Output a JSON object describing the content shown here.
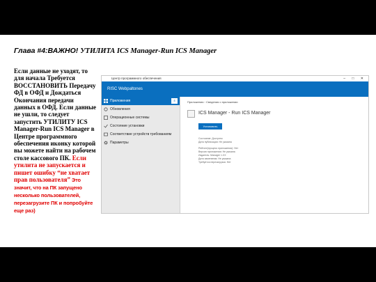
{
  "slide": {
    "title_part1": "Глава #4:ВАЖНО!",
    "title_part2": "УТИЛИТА ICS Manager-Run ICS Manager",
    "body": "Если данные не уходят, то для начала Требуется ВОССТАНОВИТЬ Передачу ФД в ОФД и Дождаться Окончания передачи данных в ОФД. Если данные не ушли, то следует запустить УТИЛИТУ ICS Manager-Run ICS Manager в Центре программного обеспечения иконку которой вы можете найти на рабочем столе кассового ПК.",
    "warning_serif": "Если утилита не запускается и пишет ошибку “не хватает прав пользователя”",
    "warning_sans": " Это значит, что на ПК запущено несколько пользователей, перезагрузите ПК и попробуйте еще раз)"
  },
  "window": {
    "titlebar": "Центр программного обеспечения",
    "controls": "–  □  ✕",
    "header": "RISC Webpaltones",
    "sidebar": [
      {
        "label": "Приложения",
        "icon": "apps-icon",
        "count": "4",
        "active": true
      },
      {
        "label": "Обновления",
        "icon": "refresh-icon"
      },
      {
        "label": "Операционные системы",
        "icon": "os-icon"
      },
      {
        "label": "Состояние установки",
        "icon": "status-icon"
      },
      {
        "label": "Соответствие устройств требованиям",
        "icon": "compliance-icon"
      },
      {
        "label": "Параметры",
        "icon": "settings-icon"
      }
    ],
    "breadcrumb": {
      "first": "Приложения",
      "second": "Сведения о приложении"
    },
    "app": {
      "name": "ICS Manager - Run ICS Manager",
      "install_label": "Установить",
      "info": [
        "Состояние: Доступно",
        "Дата публикации: Не указана",
        "Рейтинг(процесс приложения): Нет",
        "Версия приложения: Не указана",
        "Издатель: Manager 1.XX",
        "Дата изменения: Не указана",
        "Требуется перезагрузка: Нет"
      ]
    }
  },
  "colors": {
    "accent": "#0a6fbf",
    "warning": "#e00000"
  }
}
